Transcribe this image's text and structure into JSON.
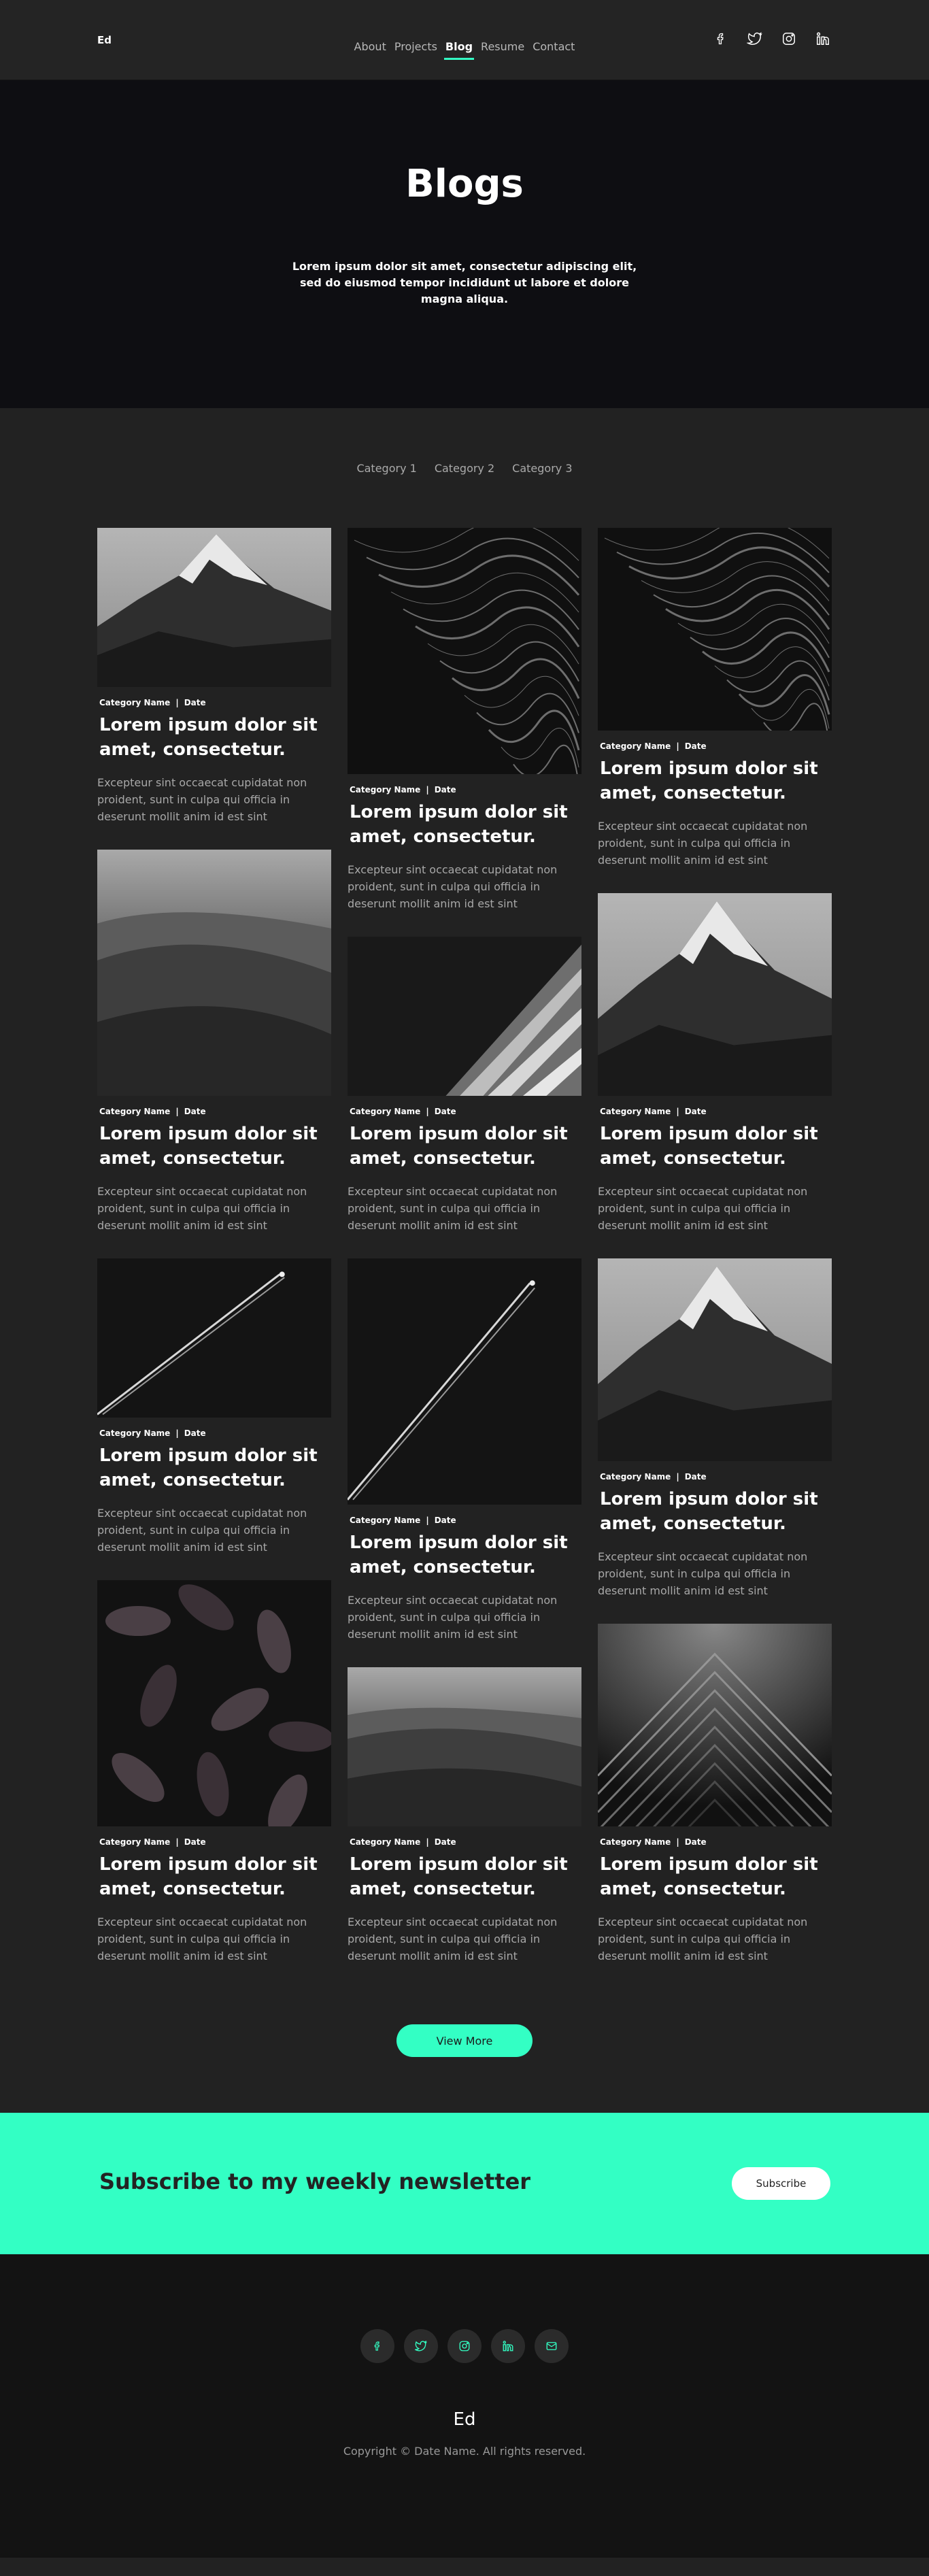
{
  "nav": {
    "logo": "Ed",
    "items": [
      {
        "label": "About",
        "active": false
      },
      {
        "label": "Projects",
        "active": false
      },
      {
        "label": "Blog",
        "active": true
      },
      {
        "label": "Resume",
        "active": false
      },
      {
        "label": "Contact",
        "active": false
      }
    ],
    "social_icons": [
      "facebook-icon",
      "twitter-icon",
      "instagram-icon",
      "linkedin-icon"
    ]
  },
  "hero": {
    "title": "Blogs",
    "subtitle": "Lorem ipsum dolor sit amet, consectetur adipiscing elit, sed do eiusmod tempor incididunt ut labore et dolore magna aliqua."
  },
  "categories": [
    "Category 1",
    "Category 2",
    "Category 3"
  ],
  "posts": [
    {
      "col": 1,
      "image": "mountain",
      "category": "Category Name",
      "date": "Date",
      "title": "Lorem ipsum dolor sit amet, consectetur.",
      "excerpt": "Excepteur sint occaecat cupidatat non proident, sunt in culpa qui officia in deserunt mollit anim id est sint"
    },
    {
      "col": 1,
      "image": "dunes",
      "category": "Category Name",
      "date": "Date",
      "title": "Lorem ipsum dolor sit amet, consectetur.",
      "excerpt": "Excepteur sint occaecat cupidatat non proident, sunt in culpa qui officia in deserunt mollit anim id est sint"
    },
    {
      "col": 1,
      "image": "plane",
      "category": "Category Name",
      "date": "Date",
      "title": "Lorem ipsum dolor sit amet, consectetur.",
      "excerpt": "Excepteur sint occaecat cupidatat non proident, sunt in culpa qui officia in deserunt mollit anim id est sint"
    },
    {
      "col": 1,
      "image": "leaves",
      "category": "Category Name",
      "date": "Date",
      "title": "Lorem ipsum dolor sit amet, consectetur.",
      "excerpt": "Excepteur sint occaecat cupidatat non proident, sunt in culpa qui officia in deserunt mollit anim id est sint"
    },
    {
      "col": 2,
      "image": "water",
      "category": "Category Name",
      "date": "Date",
      "title": "Lorem ipsum dolor sit amet, consectetur.",
      "excerpt": "Excepteur sint occaecat cupidatat non proident, sunt in culpa qui officia in deserunt mollit anim id est sint"
    },
    {
      "col": 2,
      "image": "building",
      "category": "Category Name",
      "date": "Date",
      "title": "Lorem ipsum dolor sit amet, consectetur.",
      "excerpt": "Excepteur sint occaecat cupidatat non proident, sunt in culpa qui officia in deserunt mollit anim id est sint"
    },
    {
      "col": 2,
      "image": "plane",
      "category": "Category Name",
      "date": "Date",
      "title": "Lorem ipsum dolor sit amet, consectetur.",
      "excerpt": "Excepteur sint occaecat cupidatat non proident, sunt in culpa qui officia in deserunt mollit anim id est sint"
    },
    {
      "col": 2,
      "image": "dunes",
      "category": "Category Name",
      "date": "Date",
      "title": "Lorem ipsum dolor sit amet, consectetur.",
      "excerpt": "Excepteur sint occaecat cupidatat non proident, sunt in culpa qui officia in deserunt mollit anim id est sint"
    },
    {
      "col": 3,
      "image": "water",
      "category": "Category Name",
      "date": "Date",
      "title": "Lorem ipsum dolor sit amet, consectetur.",
      "excerpt": "Excepteur sint occaecat cupidatat non proident, sunt in culpa qui officia in deserunt mollit anim id est sint"
    },
    {
      "col": 3,
      "image": "mountain",
      "category": "Category Name",
      "date": "Date",
      "title": "Lorem ipsum dolor sit amet, consectetur.",
      "excerpt": "Excepteur sint occaecat cupidatat non proident, sunt in culpa qui officia in deserunt mollit anim id est sint"
    },
    {
      "col": 3,
      "image": "mountain",
      "category": "Category Name",
      "date": "Date",
      "title": "Lorem ipsum dolor sit amet, consectetur.",
      "excerpt": "Excepteur sint occaecat cupidatat non proident, sunt in culpa qui officia in deserunt mollit anim id est sint"
    },
    {
      "col": 3,
      "image": "chevrons",
      "category": "Category Name",
      "date": "Date",
      "title": "Lorem ipsum dolor sit amet, consectetur.",
      "excerpt": "Excepteur sint occaecat cupidatat non proident, sunt in culpa qui officia in deserunt mollit anim id est sint"
    }
  ],
  "view_more_label": "View More",
  "newsletter": {
    "heading": "Subscribe to my weekly newsletter",
    "button_label": "Subscribe"
  },
  "footer": {
    "social_icons": [
      "facebook-icon",
      "twitter-icon",
      "instagram-icon",
      "linkedin-icon",
      "mail-icon"
    ],
    "logo": "Ed",
    "copyright": "Copyright © Date Name. All rights reserved."
  },
  "colors": {
    "accent": "#33ffc4",
    "hero_bg": "#0e0e12",
    "page_bg": "#222222",
    "footer_bg": "#131313"
  }
}
